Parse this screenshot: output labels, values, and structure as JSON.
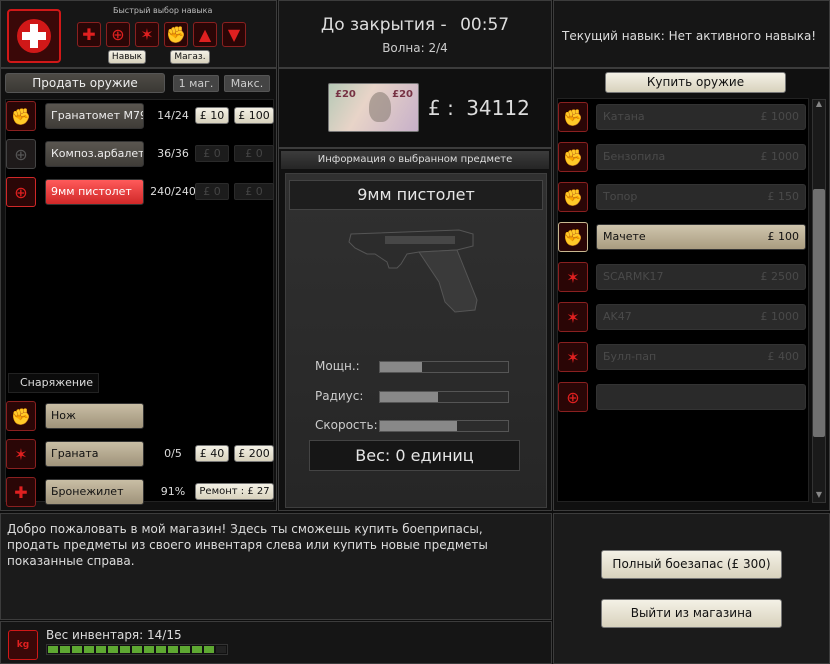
{
  "skill_quick_select": {
    "label": "Быстрый выбор навыка",
    "skill_btn": "Навык",
    "shop_btn": "Магаз."
  },
  "header": {
    "closing_label": "До закрытия -",
    "timer": "00:57",
    "wave": "Волна: 2/4",
    "current_skill": "Текущий навык: Нет активного навыка!"
  },
  "money": {
    "symbol": "£ :",
    "amount": "34112"
  },
  "sell": {
    "title": "Продать оружие",
    "mag_btn": "1 маг.",
    "max_btn": "Макс.",
    "weapons": [
      {
        "name": "Гранатомет M79",
        "ammo": "14/24",
        "price1": "£ 10",
        "price2": "£ 100",
        "icon": "fist-icon"
      },
      {
        "name": "Композ.арбалет",
        "ammo": "36/36",
        "price1": "£ 0",
        "price2": "£ 0",
        "icon": "crosshair-icon"
      },
      {
        "name": "9мм пистолет",
        "ammo": "240/240",
        "price1": "£ 0",
        "price2": "£ 0",
        "icon": "crosshair-icon"
      }
    ],
    "equipment_label": "Снаряжение",
    "equipment": [
      {
        "name": "Нож",
        "ammo": "",
        "price1": "",
        "price2": "",
        "icon": "fist-icon"
      },
      {
        "name": "Граната",
        "ammo": "0/5",
        "price1": "£ 40",
        "price2": "£ 200",
        "icon": "star-icon"
      },
      {
        "name": "Бронежилет",
        "ammo": "91%",
        "repair": "Ремонт : £ 27",
        "icon": "medic-cross-icon"
      }
    ]
  },
  "info": {
    "title": "Информация о выбранном предмете",
    "item_name": "9мм пистолет",
    "stats": [
      {
        "label": "Мощн.:",
        "value": 0.33
      },
      {
        "label": "Радиус:",
        "value": 0.45
      },
      {
        "label": "Скорость:",
        "value": 0.6
      }
    ],
    "weight": "Вес: 0 единиц"
  },
  "buy": {
    "title": "Купить оружие",
    "items": [
      {
        "name": "Катана",
        "price": "£ 1000",
        "icon": "fist-icon"
      },
      {
        "name": "Бензопила",
        "price": "£ 1000",
        "icon": "fist-icon"
      },
      {
        "name": "Топор",
        "price": "£ 150",
        "icon": "fist-icon"
      },
      {
        "name": "Мачете",
        "price": "£ 100",
        "icon": "fist-icon"
      },
      {
        "name": "SCARMK17",
        "price": "£ 2500",
        "icon": "star-icon"
      },
      {
        "name": "AK47",
        "price": "£ 1000",
        "icon": "star-icon"
      },
      {
        "name": "Булл-пап",
        "price": "£ 400",
        "icon": "star-icon"
      },
      {
        "name": "",
        "price": "",
        "icon": "crosshair-icon"
      }
    ]
  },
  "message": "Добро пожаловать в мой магазин! Здесь ты сможешь купить боеприпасы, продать предметы из своего инвентаря слева или купить новые предметы показанные справа.",
  "actions": {
    "full_ammo": "Полный боезапас (£ 300)",
    "exit": "Выйти из магазина"
  },
  "inventory": {
    "weight_label": "Вес инвентаря: 14/15",
    "filled": 14,
    "total": 15
  },
  "colors": {
    "accent_red": "#e02020",
    "selected_red": "#ff5a5a",
    "button_light": "#f4f1e6"
  }
}
